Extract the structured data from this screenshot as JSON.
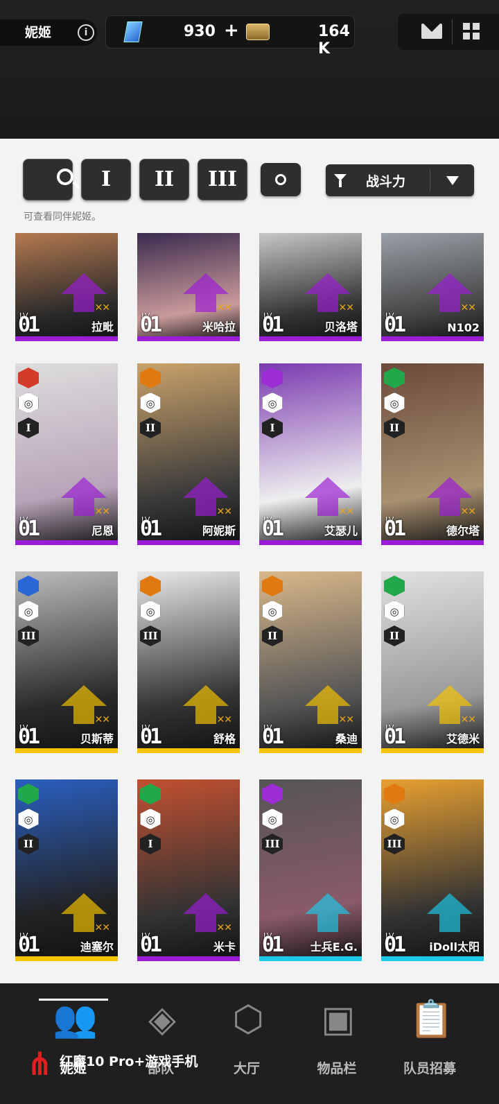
{
  "header": {
    "profile_name": "妮姬",
    "info_icon": "i",
    "gems": "930",
    "gems_plus": "+",
    "credits": "164 K"
  },
  "filters": {
    "tier1": "I",
    "tier2": "II",
    "tier3": "III",
    "sort_label": "战斗力",
    "hint": "可查看同伴妮姬。"
  },
  "cards": [
    {
      "name": "拉毗",
      "level": "01",
      "tier": "",
      "bar": "#9b1cd6",
      "burst": "",
      "element": "",
      "stars": "✕✕",
      "art": [
        "#b4794f",
        "#2a2a2a"
      ]
    },
    {
      "name": "米哈拉",
      "level": "01",
      "tier": "",
      "bar": "#9b1cd6",
      "burst": "",
      "element": "",
      "stars": "✕✕",
      "art": [
        "#3a2b4e",
        "#c99a9a"
      ]
    },
    {
      "name": "贝洛塔",
      "level": "01",
      "tier": "",
      "bar": "#9b1cd6",
      "burst": "",
      "element": "",
      "stars": "✕✕",
      "art": [
        "#c7c7c7",
        "#333"
      ]
    },
    {
      "name": "N102",
      "level": "01",
      "tier": "",
      "bar": "#9b1cd6",
      "burst": "",
      "element": "",
      "stars": "✕✕",
      "art": [
        "#9aa0a8",
        "#444"
      ]
    },
    {
      "name": "尼恩",
      "level": "01",
      "tier": "I",
      "bar": "#9b1cd6",
      "burst": "◎",
      "element": "火",
      "stars": "✕✕",
      "art": [
        "#ddd",
        "#b8a3b8"
      ]
    },
    {
      "name": "阿妮斯",
      "level": "01",
      "tier": "II",
      "bar": "#9b1cd6",
      "burst": "◎",
      "element": "铁",
      "stars": "✕✕",
      "art": [
        "#c9a26a",
        "#3a3a3a"
      ]
    },
    {
      "name": "艾瑟儿",
      "level": "01",
      "tier": "I",
      "bar": "#9b1cd6",
      "burst": "◎",
      "element": "电",
      "stars": "✕✕",
      "art": [
        "#7b3bb0",
        "#eee"
      ]
    },
    {
      "name": "德尔塔",
      "level": "01",
      "tier": "II",
      "bar": "#9b1cd6",
      "burst": "◎",
      "element": "风",
      "stars": "✕✕",
      "art": [
        "#6b4a3a",
        "#a89070"
      ]
    },
    {
      "name": "贝斯蒂",
      "level": "01",
      "tier": "III",
      "bar": "#f5c400",
      "burst": "◎",
      "element": "水",
      "stars": "✕✕",
      "art": [
        "#bcbcbc",
        "#2a2a2a"
      ]
    },
    {
      "name": "舒格",
      "level": "01",
      "tier": "III",
      "bar": "#f5c400",
      "burst": "◎",
      "element": "铁",
      "stars": "✕✕",
      "art": [
        "#e8e8e8",
        "#333"
      ]
    },
    {
      "name": "桑迪",
      "level": "01",
      "tier": "II",
      "bar": "#f5c400",
      "burst": "◎",
      "element": "铁",
      "stars": "✕✕",
      "art": [
        "#d9b88a",
        "#555"
      ]
    },
    {
      "name": "艾德米",
      "level": "01",
      "tier": "II",
      "bar": "#f5c400",
      "burst": "◎",
      "element": "风",
      "stars": "✕✕",
      "art": [
        "#e0e0e0",
        "#999"
      ]
    },
    {
      "name": "迪塞尔",
      "level": "01",
      "tier": "II",
      "bar": "#f5c400",
      "burst": "◎",
      "element": "风",
      "stars": "✕✕",
      "art": [
        "#2a5fc0",
        "#222"
      ]
    },
    {
      "name": "米卡",
      "level": "01",
      "tier": "I",
      "bar": "#9b1cd6",
      "burst": "◎",
      "element": "风",
      "stars": "✕✕",
      "art": [
        "#c25030",
        "#333"
      ]
    },
    {
      "name": "士兵E.G.",
      "level": "01",
      "tier": "III",
      "bar": "#1ec8e8",
      "burst": "◎",
      "element": "电",
      "stars": "",
      "art": [
        "#555",
        "#8a5a6a"
      ]
    },
    {
      "name": "iDoll太阳",
      "level": "01",
      "tier": "III",
      "bar": "#1ec8e8",
      "burst": "◎",
      "element": "铁",
      "stars": "",
      "art": [
        "#e8a030",
        "#333"
      ]
    }
  ],
  "level_prefix": "LV.",
  "nav": {
    "n1": "妮姬",
    "n2": "部队",
    "n3": "大厅",
    "n4": "物品栏",
    "n5": "队员招募"
  },
  "watermark": "红魔10 Pro+游戏手机"
}
